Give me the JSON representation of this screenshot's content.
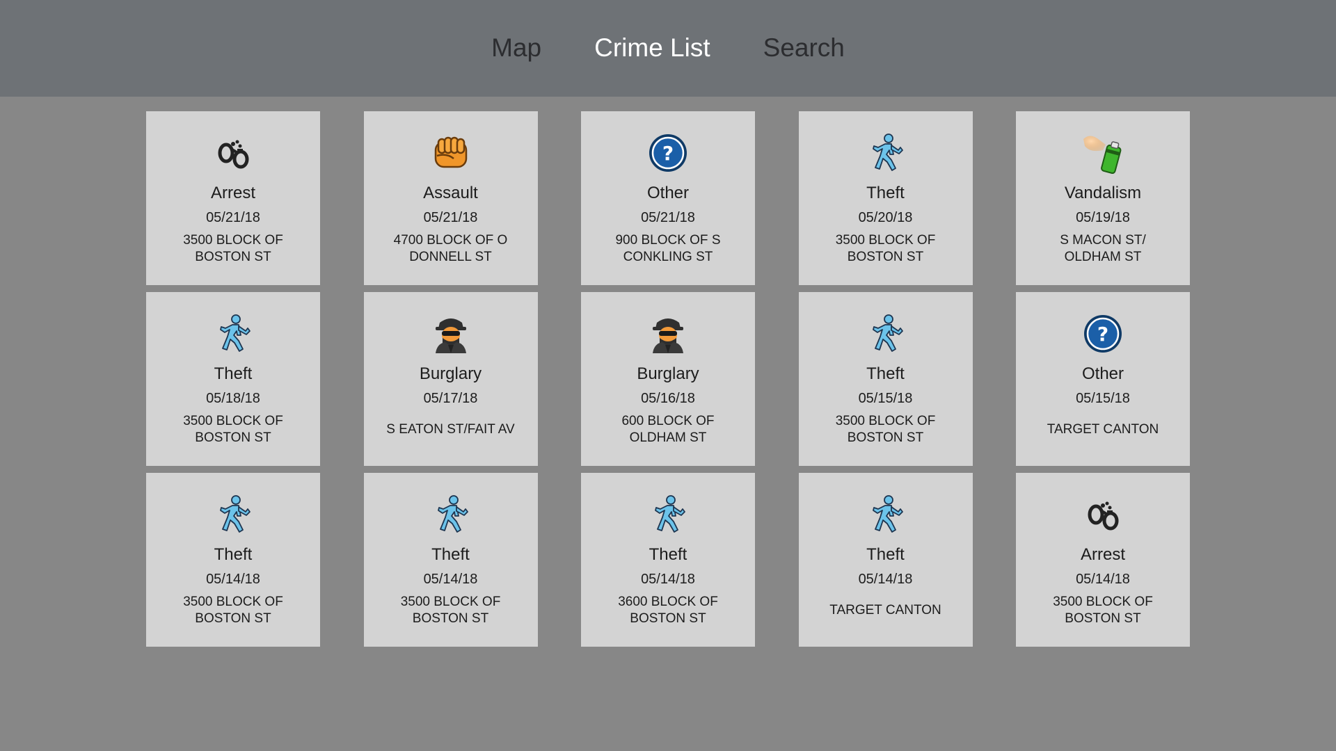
{
  "nav": {
    "tabs": [
      {
        "label": "Map",
        "active": false
      },
      {
        "label": "Crime List",
        "active": true
      },
      {
        "label": "Search",
        "active": false
      }
    ]
  },
  "crimes": [
    {
      "type": "Arrest",
      "date": "05/21/18",
      "address": "3500 BLOCK OF BOSTON ST",
      "icon": "handcuffs-icon"
    },
    {
      "type": "Assault",
      "date": "05/21/18",
      "address": "4700 BLOCK OF O DONNELL ST",
      "icon": "fist-icon"
    },
    {
      "type": "Other",
      "date": "05/21/18",
      "address": "900 BLOCK OF S CONKLING ST",
      "icon": "question-icon"
    },
    {
      "type": "Theft",
      "date": "05/20/18",
      "address": "3500 BLOCK OF BOSTON ST",
      "icon": "running-person-icon"
    },
    {
      "type": "Vandalism",
      "date": "05/19/18",
      "address": "S MACON ST/ OLDHAM ST",
      "icon": "spray-can-icon"
    },
    {
      "type": "Theft",
      "date": "05/18/18",
      "address": "3500 BLOCK OF BOSTON ST",
      "icon": "running-person-icon"
    },
    {
      "type": "Burglary",
      "date": "05/17/18",
      "address": "S EATON ST/FAIT AV",
      "icon": "burglar-icon"
    },
    {
      "type": "Burglary",
      "date": "05/16/18",
      "address": "600 BLOCK OF OLDHAM ST",
      "icon": "burglar-icon"
    },
    {
      "type": "Theft",
      "date": "05/15/18",
      "address": "3500 BLOCK OF BOSTON ST",
      "icon": "running-person-icon"
    },
    {
      "type": "Other",
      "date": "05/15/18",
      "address": "TARGET CANTON",
      "icon": "question-icon"
    },
    {
      "type": "Theft",
      "date": "05/14/18",
      "address": "3500 BLOCK OF BOSTON ST",
      "icon": "running-person-icon"
    },
    {
      "type": "Theft",
      "date": "05/14/18",
      "address": "3500 BLOCK OF BOSTON ST",
      "icon": "running-person-icon"
    },
    {
      "type": "Theft",
      "date": "05/14/18",
      "address": "3600 BLOCK OF BOSTON ST",
      "icon": "running-person-icon"
    },
    {
      "type": "Theft",
      "date": "05/14/18",
      "address": "TARGET CANTON",
      "icon": "running-person-icon"
    },
    {
      "type": "Arrest",
      "date": "05/14/18",
      "address": "3500 BLOCK OF BOSTON ST",
      "icon": "handcuffs-icon"
    }
  ]
}
